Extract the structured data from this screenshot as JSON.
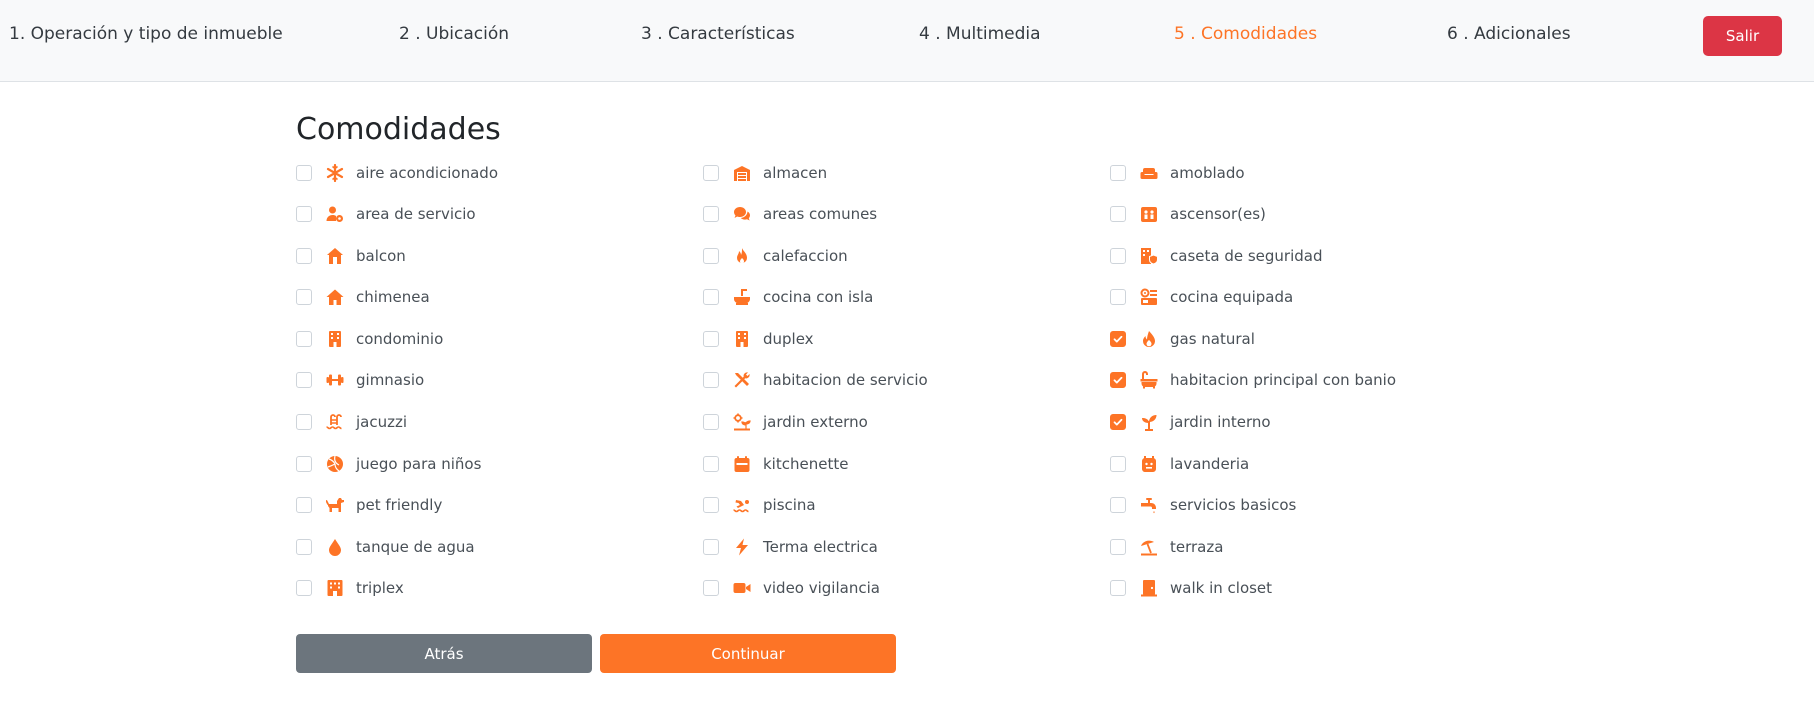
{
  "steps": {
    "s1": "1. Operación y tipo de inmueble",
    "s2": "2 . Ubicación",
    "s3": "3 . Características",
    "s4": "4 . Multimedia",
    "s5": "5 . Comodidades",
    "s6": "6 . Adicionales"
  },
  "exit_label": "Salir",
  "title": "Comodidades",
  "colors": {
    "accent": "#fd7426",
    "danger": "#dc3545",
    "secondary": "#6c757d"
  },
  "amenities": [
    {
      "label": "aire acondicionado",
      "icon": "snowflake-icon",
      "checked": false
    },
    {
      "label": "almacen",
      "icon": "warehouse-icon",
      "checked": false
    },
    {
      "label": "amoblado",
      "icon": "couch-icon",
      "checked": false
    },
    {
      "label": "area de servicio",
      "icon": "user-cog-icon",
      "checked": false
    },
    {
      "label": "areas comunes",
      "icon": "comments-icon",
      "checked": false
    },
    {
      "label": "ascensor(es)",
      "icon": "elevator-icon",
      "checked": false
    },
    {
      "label": "balcon",
      "icon": "house-icon",
      "checked": false
    },
    {
      "label": "calefaccion",
      "icon": "fire-icon",
      "checked": false
    },
    {
      "label": "caseta de seguridad",
      "icon": "building-shield-icon",
      "checked": false
    },
    {
      "label": "chimenea",
      "icon": "home-icon",
      "checked": false
    },
    {
      "label": "cocina con isla",
      "icon": "sink-icon",
      "checked": false
    },
    {
      "label": "cocina equipada",
      "icon": "kitchen-icon",
      "checked": false
    },
    {
      "label": "condominio",
      "icon": "building-icon",
      "checked": false
    },
    {
      "label": "duplex",
      "icon": "building-icon",
      "checked": false
    },
    {
      "label": "gas natural",
      "icon": "flame-icon",
      "checked": true
    },
    {
      "label": "gimnasio",
      "icon": "dumbbell-icon",
      "checked": false
    },
    {
      "label": "habitacion de servicio",
      "icon": "tools-icon",
      "checked": false
    },
    {
      "label": "habitacion principal con banio",
      "icon": "bath-icon",
      "checked": true
    },
    {
      "label": "jacuzzi",
      "icon": "pool-icon",
      "checked": false
    },
    {
      "label": "jardin externo",
      "icon": "garden-icon",
      "checked": false
    },
    {
      "label": "jardin interno",
      "icon": "plant-icon",
      "checked": true
    },
    {
      "label": "juego para niños",
      "icon": "volleyball-icon",
      "checked": false
    },
    {
      "label": "kitchenette",
      "icon": "calendar-icon",
      "checked": false
    },
    {
      "label": "lavanderia",
      "icon": "laundry-icon",
      "checked": false
    },
    {
      "label": "pet friendly",
      "icon": "dog-icon",
      "checked": false
    },
    {
      "label": "piscina",
      "icon": "swimmer-icon",
      "checked": false
    },
    {
      "label": "servicios basicos",
      "icon": "faucet-icon",
      "checked": false
    },
    {
      "label": "tanque de agua",
      "icon": "droplet-icon",
      "checked": false
    },
    {
      "label": "Terma electrica",
      "icon": "bolt-icon",
      "checked": false
    },
    {
      "label": "terraza",
      "icon": "umbrella-beach-icon",
      "checked": false
    },
    {
      "label": "triplex",
      "icon": "hotel-icon",
      "checked": false
    },
    {
      "label": "video vigilancia",
      "icon": "video-icon",
      "checked": false
    },
    {
      "label": "walk in closet",
      "icon": "door-icon",
      "checked": false
    }
  ],
  "back_label": "Atrás",
  "next_label": "Continuar"
}
